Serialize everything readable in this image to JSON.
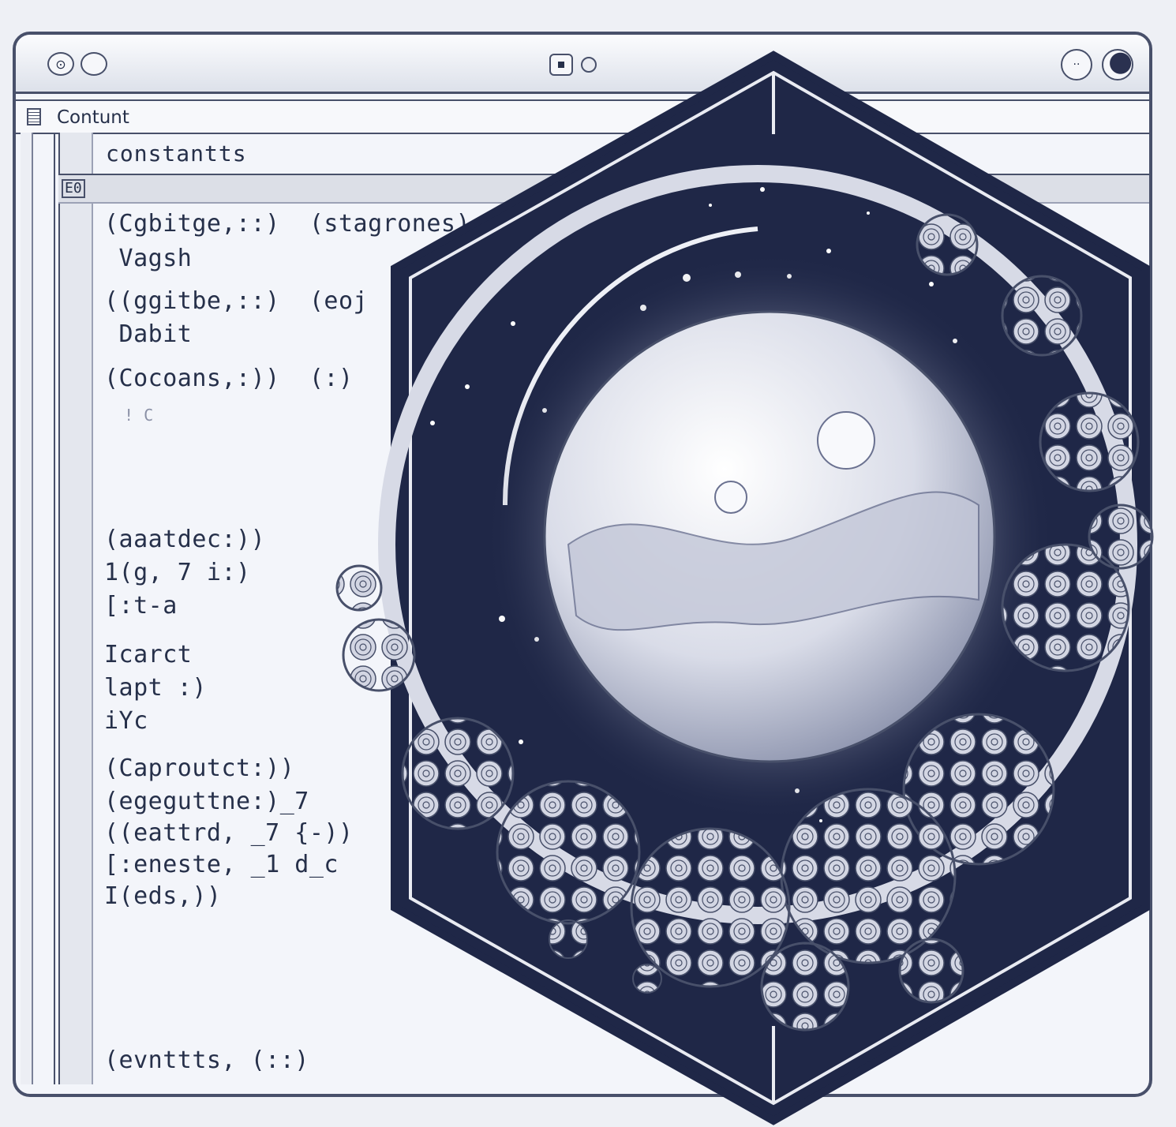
{
  "window": {
    "menu_label": "Contunt",
    "section_title": "constantts",
    "section_bar_icon": "E0"
  },
  "titlebar": {
    "left_buttons": [
      "circle-a-icon",
      "circle-icon"
    ],
    "center_buttons": [
      "square-stop-icon",
      "dot-icon"
    ],
    "right_buttons": [
      "dots-icon",
      "moon-icon"
    ]
  },
  "code_lines": [
    "(Cgbitge,::)  (stagrones)",
    " Vagsh",
    "((ggitbe,::)  (eoj",
    " Dabit",
    "(Cocoans,:))  (:)",
    "  ! C",
    "(aaatdec:))",
    "1(g, 7 i:)",
    "[:t-a",
    "Icarct",
    "lapt :)",
    "iYc",
    "(Caproutct:))",
    "(egeguttne:)_7",
    "((eattrd, _7 {-))",
    "[:eneste, _1 d_c",
    "I(eds,))",
    "(evnttts, (::)"
  ],
  "colors": {
    "navy": "#1f2747",
    "frame": "#48506a",
    "background": "#eef0f5"
  }
}
